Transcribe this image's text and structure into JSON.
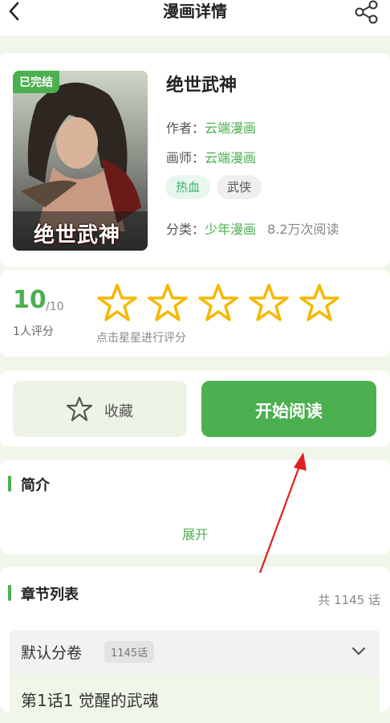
{
  "header": {
    "title": "漫画详情",
    "back_icon": "back-arrow-icon",
    "share_icon": "share-icon"
  },
  "comic": {
    "badge": "已完结",
    "cover_title": "绝世武神",
    "name": "绝世武神",
    "author_label": "作者：",
    "author": "云端漫画",
    "artist_label": "画师：",
    "artist": "云端漫画",
    "tags": [
      "热血",
      "武侠"
    ],
    "category_label": "分类：",
    "category": "少年漫画",
    "reads": "8.2万次阅读"
  },
  "rating": {
    "score": "10",
    "max": "/10",
    "people": "1人评分",
    "hint": "点击星星进行评分",
    "stars": 5
  },
  "actions": {
    "favorite_label": "收藏",
    "read_label": "开始阅读"
  },
  "intro": {
    "title": "简介",
    "expand_label": "展开"
  },
  "chapters": {
    "title": "章节列表",
    "total": "共 1145 话",
    "volume_name": "默认分卷",
    "volume_count": "1145话",
    "first_chapter": "第1话1 觉醒的武魂"
  },
  "colors": {
    "accent": "#4caf50",
    "star": "#f5b800",
    "annotation_arrow": "#e02020",
    "background": "#f1f6ea"
  }
}
